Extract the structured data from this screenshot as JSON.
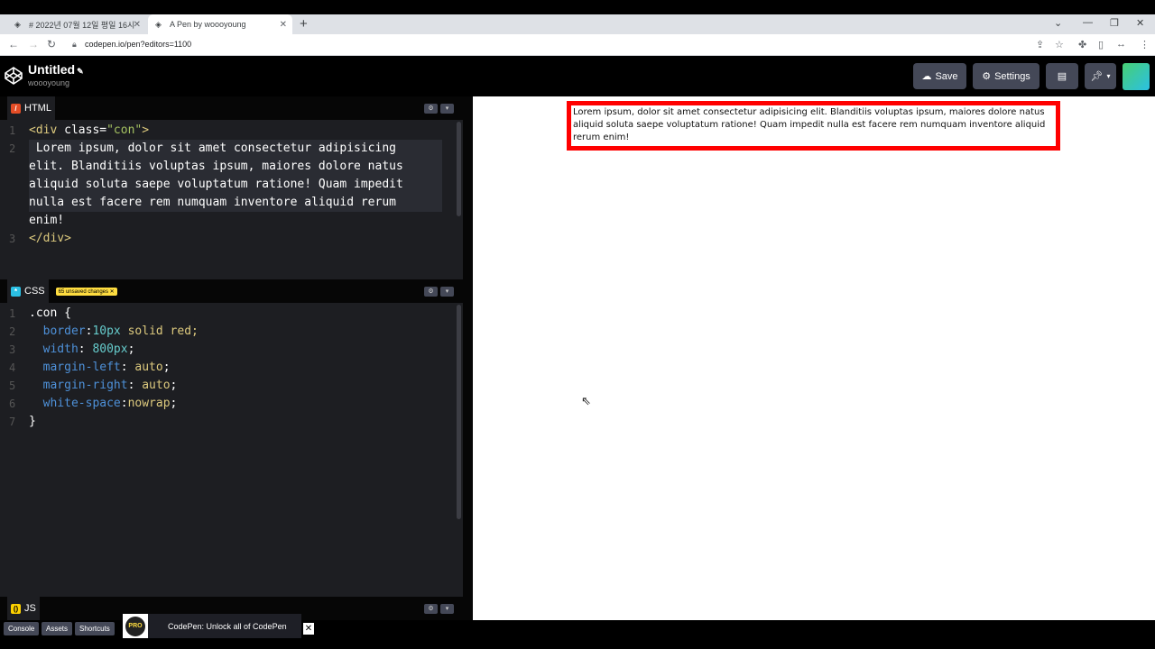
{
  "browser": {
    "tabs": [
      {
        "label": "# 2022년 07월 12일 평일 16시"
      },
      {
        "label": "A Pen by woooyoung"
      }
    ],
    "new_tab": "+",
    "url": "codepen.io/pen?editors=1100"
  },
  "header": {
    "title": "Untitled",
    "author": "woooyoung",
    "save_label": "Save",
    "settings_label": "Settings"
  },
  "editors": {
    "html": {
      "label": "HTML",
      "lines": [
        "1",
        "2",
        "3"
      ],
      "code_line1_tag_open": "<div",
      "code_line1_attr": " class=",
      "code_line1_value": "\"con\"",
      "code_line1_close": ">",
      "code_line2": [
        " Lorem ipsum, dolor sit amet consectetur adipisicing",
        "elit. Blanditiis voluptas ipsum, maiores dolore natus",
        "aliquid soluta saepe voluptatum ratione! Quam impedit",
        "nulla est facere rem numquam inventore aliquid rerum",
        "enim!"
      ],
      "code_line3": "</div>"
    },
    "css": {
      "label": "CSS",
      "unsaved": "65 unsaved changes",
      "lines": [
        "1",
        "2",
        "3",
        "4",
        "5",
        "6",
        "7"
      ],
      "selector": ".con {",
      "rules": [
        {
          "prop": "border",
          "sep": ":",
          "val": "10px",
          "rest": " solid red;"
        },
        {
          "prop": "width",
          "sep": ": ",
          "val": "800px",
          "rest": ";"
        },
        {
          "prop": "margin-left",
          "sep": ": ",
          "val": "auto",
          "rest": ";"
        },
        {
          "prop": "margin-right",
          "sep": ": ",
          "val": "auto",
          "rest": ";"
        },
        {
          "prop": "white-space",
          "sep": ":",
          "val": "nowrap",
          "rest": ";"
        }
      ],
      "close": "}"
    },
    "js": {
      "label": "JS"
    }
  },
  "preview": {
    "text": "Lorem ipsum, dolor sit amet consectetur adipisicing elit. Blanditiis voluptas ipsum, maiores dolore natus aliquid soluta saepe voluptatum ratione! Quam impedit nulla est facere rem numquam inventore aliquid rerum enim!"
  },
  "bottom": {
    "console": "Console",
    "assets": "Assets",
    "shortcuts": "Shortcuts",
    "promo": "CodePen: Unlock all of CodePen",
    "pro": "PRO"
  }
}
